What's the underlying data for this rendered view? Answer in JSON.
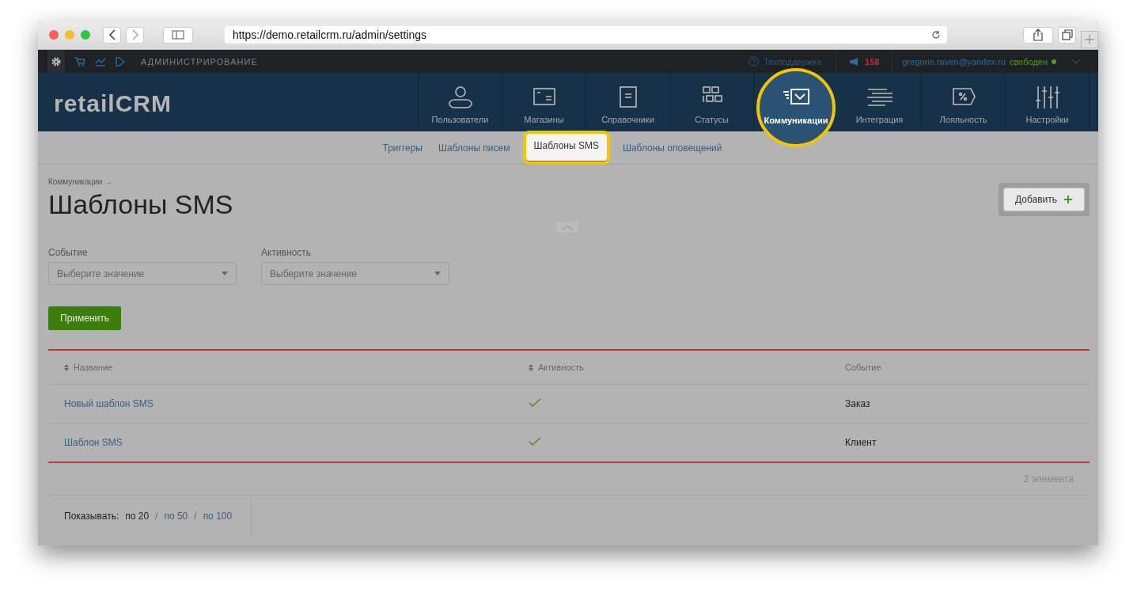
{
  "browser": {
    "url": "https://demo.retailcrm.ru/admin/settings"
  },
  "top_bar": {
    "section": "АДМИНИСТРИРОВАНИЕ",
    "support": "Техподдержка",
    "notifications": "158",
    "user": "gregorio.raven@yandex.ru",
    "status": "свободен"
  },
  "logo": "retailCRM",
  "nav": [
    {
      "label": "Пользователи",
      "kind": "user",
      "selected": false,
      "highlighted": false
    },
    {
      "label": "Магазины",
      "kind": "store",
      "selected": false,
      "highlighted": false
    },
    {
      "label": "Справочники",
      "kind": "book",
      "selected": false,
      "highlighted": false
    },
    {
      "label": "Статусы",
      "kind": "grid",
      "selected": false,
      "highlighted": false
    },
    {
      "label": "Коммуникации",
      "kind": "message",
      "selected": true,
      "highlighted": true
    },
    {
      "label": "Интеграция",
      "kind": "lines",
      "selected": false,
      "highlighted": false
    },
    {
      "label": "Лояльность",
      "kind": "percent",
      "selected": false,
      "highlighted": false
    },
    {
      "label": "Настройки",
      "kind": "sliders",
      "selected": false,
      "highlighted": false
    }
  ],
  "subnav": [
    {
      "label": "Триггеры",
      "selected": false,
      "highlighted": false
    },
    {
      "label": "Шаблоны писем",
      "selected": false,
      "highlighted": false
    },
    {
      "label": "Шаблоны SMS",
      "selected": true,
      "highlighted": true
    },
    {
      "label": "Шаблоны оповещений",
      "selected": false,
      "highlighted": false
    }
  ],
  "breadcrumb": "Коммуникации →",
  "title": "Шаблоны SMS",
  "add_button": {
    "label": "Добавить",
    "highlighted": true
  },
  "filters": [
    {
      "label": "Событие",
      "placeholder": "Выберите значение"
    },
    {
      "label": "Активность",
      "placeholder": "Выберите значение"
    }
  ],
  "apply_button": "Применить",
  "table": {
    "columns": [
      {
        "label": "Название",
        "sortable": true
      },
      {
        "label": "Активность",
        "sortable": true
      },
      {
        "label": "Событие",
        "sortable": false
      }
    ],
    "rows": [
      {
        "name": "Новый шаблон SMS",
        "active": true,
        "event": "Заказ"
      },
      {
        "name": "Шаблон SMS",
        "active": true,
        "event": "Клиент"
      }
    ]
  },
  "count": "2 элемента",
  "pagination": {
    "label": "Показывать:",
    "separator": "/",
    "options": [
      {
        "label": "по 20",
        "selected": true
      },
      {
        "label": "по 50",
        "selected": false
      },
      {
        "label": "по 100",
        "selected": false
      }
    ]
  }
}
